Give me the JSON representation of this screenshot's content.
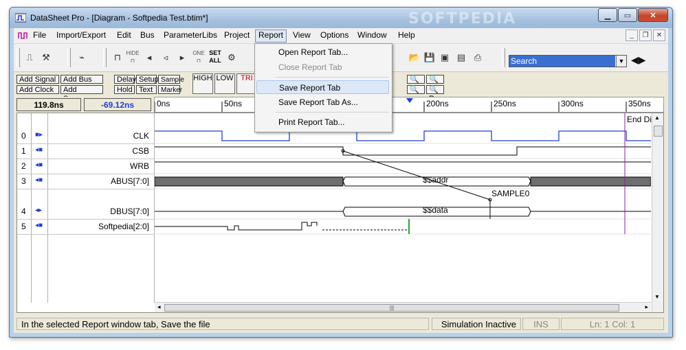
{
  "window": {
    "title": "DataSheet Pro - [Diagram - Softpedia Test.btim*]",
    "watermark": "SOFTPEDIA"
  },
  "menubar": {
    "items": [
      {
        "label": "File"
      },
      {
        "label": "Import/Export"
      },
      {
        "label": "Edit"
      },
      {
        "label": "Bus"
      },
      {
        "label": "ParameterLibs"
      },
      {
        "label": "Project"
      },
      {
        "label": "Report"
      },
      {
        "label": "View"
      },
      {
        "label": "Options"
      },
      {
        "label": "Window"
      },
      {
        "label": "Help"
      }
    ]
  },
  "report_menu": {
    "items": [
      {
        "label": "Open Report Tab...",
        "enabled": true
      },
      {
        "label": "Close Report Tab",
        "enabled": false
      },
      {
        "label": "Save Report Tab",
        "enabled": true,
        "highlighted": true
      },
      {
        "label": "Save Report Tab As...",
        "enabled": true
      },
      {
        "label": "Print Report Tab...",
        "enabled": true
      }
    ]
  },
  "toolbar": {
    "search_placeholder": "Search",
    "mini_labels": {
      "hide": "HIDE",
      "one": "ONE",
      "set": "SET",
      "all": "ALL"
    },
    "buttons_left": {
      "add_signal": "Add Signal",
      "add_bus": "Add Bus",
      "add_clock": "Add Clock",
      "add_spacer": "Add Spacer"
    },
    "buttons_mid": {
      "delay": "Delay",
      "setup": "Setup",
      "sample": "Sample",
      "hold": "Hold",
      "text": "Text",
      "marker": "Marker"
    },
    "big_buttons": {
      "high": "HIGH",
      "low": "LOW",
      "tri": "TRI"
    }
  },
  "timebar": {
    "cursor1": "119.8ns",
    "cursor2": "-69.12ns",
    "ticks": [
      "0ns",
      "50ns",
      "200ns",
      "250ns",
      "300ns",
      "350ns"
    ],
    "end_label": "End Di"
  },
  "signals": [
    {
      "index": "0",
      "name": "CLK",
      "dir": "clock"
    },
    {
      "index": "1",
      "name": "CSB",
      "dir": "input"
    },
    {
      "index": "2",
      "name": "WRB",
      "dir": "input"
    },
    {
      "index": "3",
      "name": "ABUS[7:0]",
      "dir": "input"
    },
    {
      "index": "4",
      "name": "DBUS[7:0]",
      "dir": "bidir"
    },
    {
      "index": "5",
      "name": "Softpedia[2:0]",
      "dir": "input"
    }
  ],
  "waveform_labels": {
    "addr": "$$addr",
    "data": "$$data",
    "sample": "SAMPLE0"
  },
  "status": {
    "message": "In the selected Report window tab, Save the file",
    "sim": "Simulation Inactive",
    "ins": "INS",
    "pos": "Ln: 1  Col: 1"
  },
  "colors": {
    "clock": "#1d3fd6",
    "marker": "#8b1fa8",
    "green": "#1faa2a",
    "bus_fill": "#6e6e6e"
  }
}
